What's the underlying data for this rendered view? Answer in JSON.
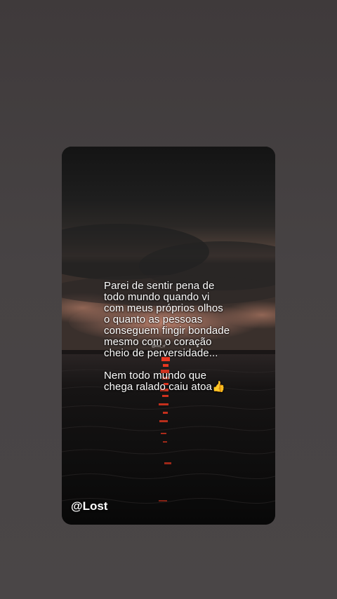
{
  "story": {
    "caption_lines_p1": [
      "Parei de sentir pena de",
      "todo mundo quando vi",
      "com meus próprios olhos",
      "o quanto as pessoas",
      "conseguem fingir bondade",
      "mesmo com o coração",
      "cheio de perversidade..."
    ],
    "caption_lines_p2": [
      "Nem todo mundo que",
      "chega ralado caiu atoa👍"
    ],
    "small_watermark": "@lost_cf",
    "handle": "@Lost"
  },
  "colors": {
    "outer_background": "#454142",
    "sky": "#1a1a1a",
    "sunset_glow": "#c9826a",
    "sun_reflection": "#ff3a20",
    "water": "#0d0d0d",
    "text": "#ffffff"
  }
}
